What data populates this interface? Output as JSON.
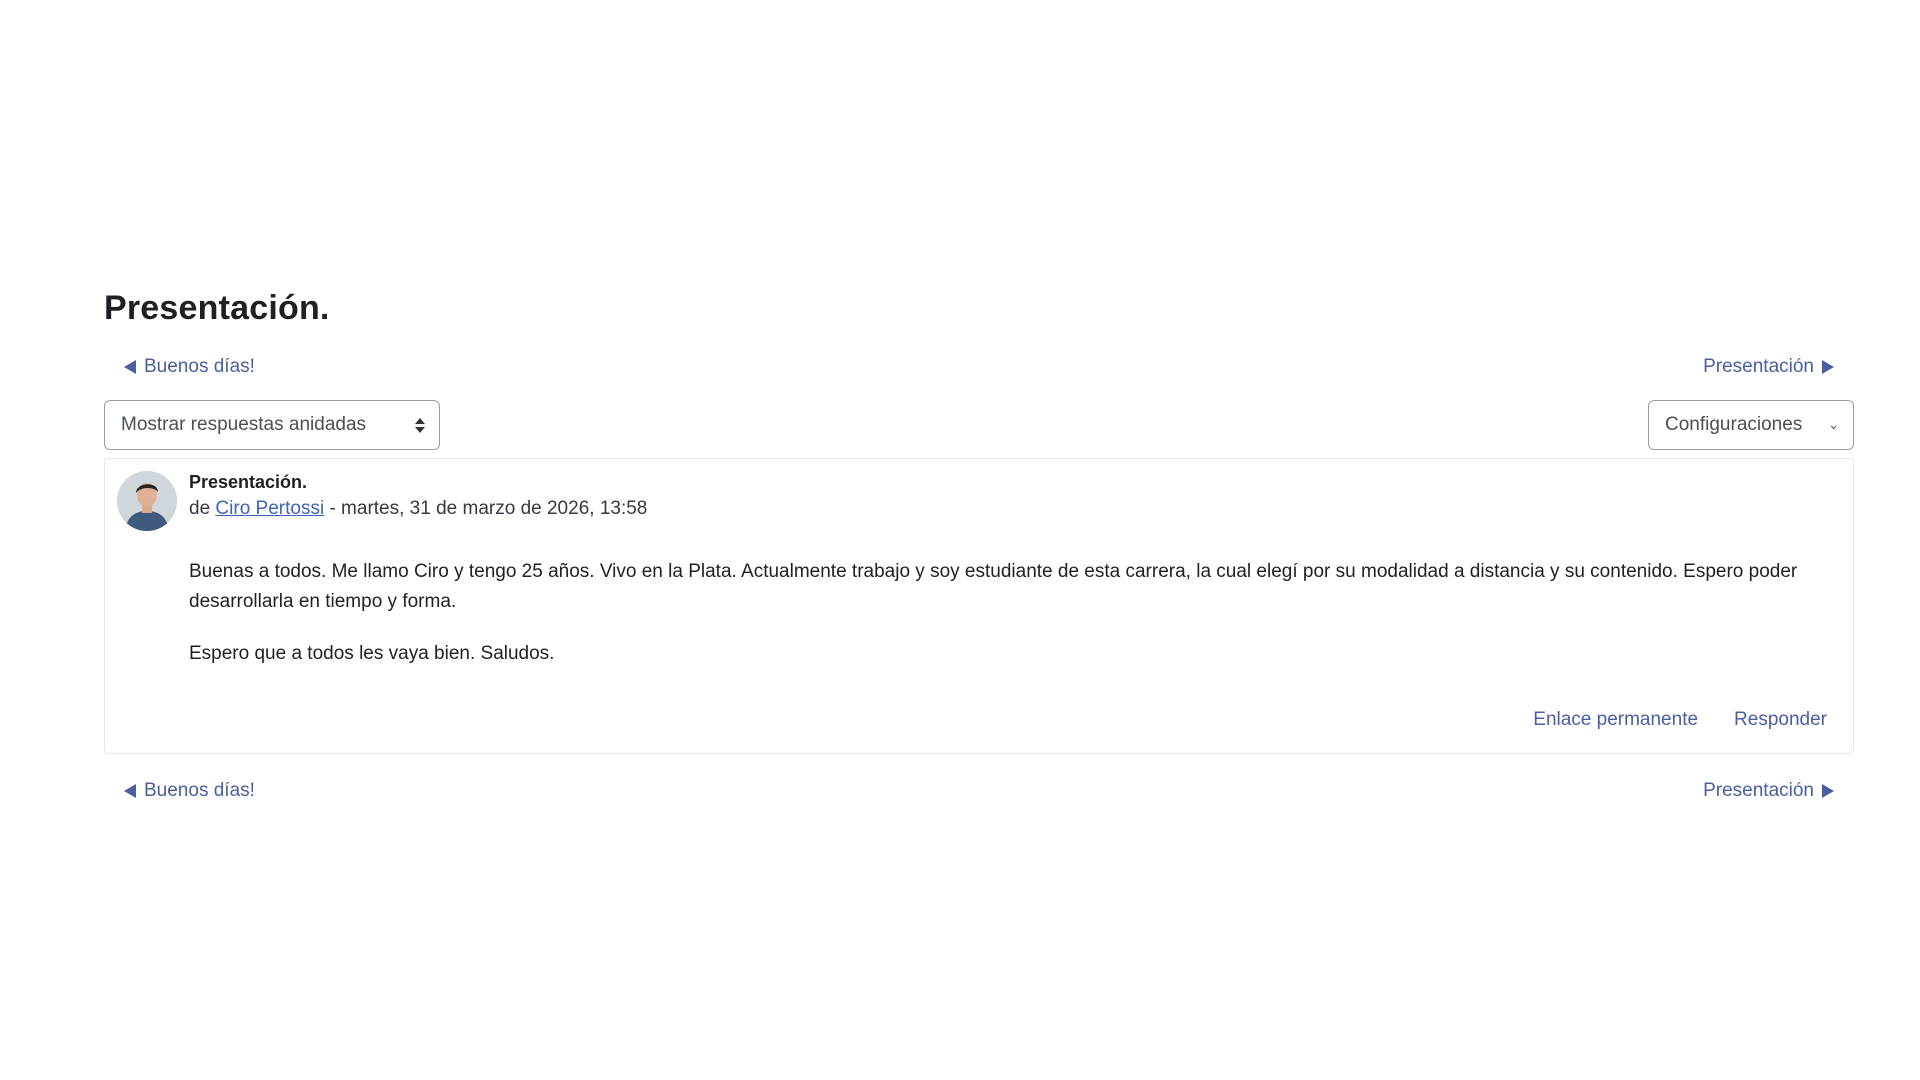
{
  "page_title": "Presentación.",
  "nav": {
    "prev_label": "Buenos días!",
    "next_label": "Presentación"
  },
  "controls": {
    "display_mode": "Mostrar respuestas anidadas",
    "settings": "Configuraciones"
  },
  "post": {
    "subject": "Presentación.",
    "by_prefix": "de",
    "author": "Ciro Pertossi",
    "date_text": "- martes, 31 de marzo de 2026, 13:58",
    "body": [
      "Buenas a todos. Me llamo Ciro y tengo 25 años. Vivo en la Plata. Actualmente trabajo y soy estudiante de esta carrera, la cual elegí por su modalidad a distancia y su contenido. Espero poder desarrollarla en tiempo y forma.",
      "Espero que a todos les vaya bien. Saludos."
    ],
    "actions": {
      "permalink": "Enlace permanente",
      "reply": "Responder"
    }
  },
  "colors": {
    "link": "#4a5fa0",
    "author_link": "#3f63b5",
    "border": "#e6e6e6"
  },
  "icons": {
    "prev": "triangle-left-icon",
    "next": "triangle-right-icon",
    "select": "updown-arrows-icon",
    "settings": "chevron-down-icon",
    "avatar": "user-avatar"
  }
}
